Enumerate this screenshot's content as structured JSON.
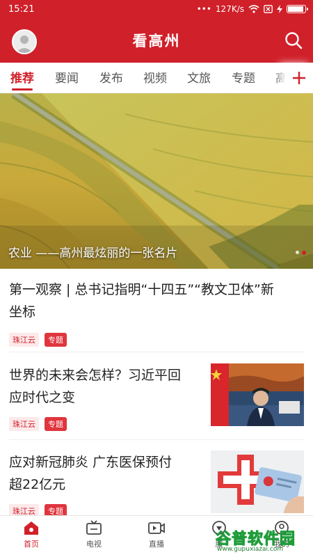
{
  "status_bar": {
    "time": "15:21",
    "network_speed": "127K/s",
    "battery_level": 0.9
  },
  "header": {
    "title": "看高州"
  },
  "tabs": [
    {
      "label": "推荐",
      "active": true
    },
    {
      "label": "要闻"
    },
    {
      "label": "发布"
    },
    {
      "label": "视频"
    },
    {
      "label": "文旅"
    },
    {
      "label": "专题"
    },
    {
      "label": "高"
    }
  ],
  "hero": {
    "caption": "农业 ——高州最炫丽的一张名片",
    "slide_count": 2,
    "active_slide": 2
  },
  "news": [
    {
      "title_line1": "第一观察 | 总书记指明“十四五”“教文卫体”新",
      "title_line2": "坐标",
      "source": "珠江云",
      "tag": "专题"
    },
    {
      "title_line1": "世界的未来会怎样？习近平回",
      "title_line2": "应时代之变",
      "source": "珠江云",
      "tag": "专题"
    },
    {
      "title_line1": "应对新冠肺炎 广东医保预付",
      "title_line2": "超22亿元",
      "source": "珠江云",
      "tag": "专题"
    }
  ],
  "bottom_nav": [
    {
      "label": "首页",
      "active": true,
      "icon": "home-icon"
    },
    {
      "label": "电视",
      "icon": "tv-icon"
    },
    {
      "label": "直播",
      "icon": "live-icon"
    },
    {
      "label": "服",
      "icon": "service-icon"
    },
    {
      "label": "我的",
      "icon": "user-icon"
    }
  ],
  "watermark": {
    "name": "谷普软件园",
    "url": "www.gupuxiazai.com"
  },
  "colors": {
    "brand_red": "#d0202a"
  }
}
